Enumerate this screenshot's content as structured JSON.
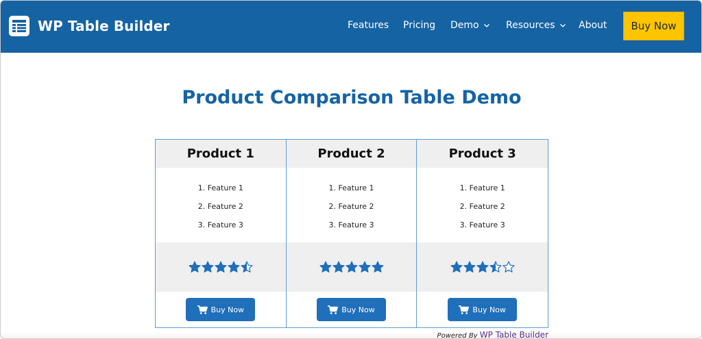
{
  "header": {
    "brand": "WP Table Builder",
    "nav": [
      {
        "label": "Features",
        "has_dropdown": false
      },
      {
        "label": "Pricing",
        "has_dropdown": false
      },
      {
        "label": "Demo",
        "has_dropdown": true
      },
      {
        "label": "Resources",
        "has_dropdown": true
      },
      {
        "label": "About",
        "has_dropdown": false
      }
    ],
    "buy_label": "Buy Now"
  },
  "page": {
    "title": "Product Comparison Table Demo"
  },
  "table": {
    "products": [
      {
        "name": "Product 1",
        "features": [
          "Feature 1",
          "Feature 2",
          "Feature 3"
        ],
        "rating": 4.5,
        "buy_label": "Buy Now"
      },
      {
        "name": "Product 2",
        "features": [
          "Feature 1",
          "Feature 2",
          "Feature 3"
        ],
        "rating": 5,
        "buy_label": "Buy Now"
      },
      {
        "name": "Product 3",
        "features": [
          "Feature 1",
          "Feature 2",
          "Feature 3"
        ],
        "rating": 3.5,
        "buy_label": "Buy Now"
      }
    ]
  },
  "footer": {
    "powered_prefix": "Powered By",
    "powered_brand": "WP Table Builder"
  },
  "colors": {
    "header_bg": "#1563a3",
    "accent_yellow": "#fdc400",
    "star_blue": "#1f6fba",
    "title_blue": "#1563a3"
  },
  "icons": {
    "logo": "table-grid-icon",
    "dropdown": "chevron-down-icon",
    "cart": "shopping-cart-icon",
    "star": "star-icon"
  }
}
